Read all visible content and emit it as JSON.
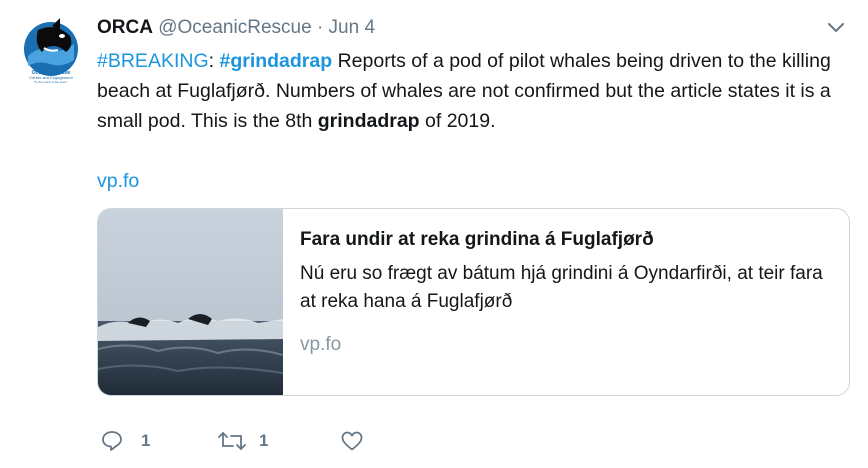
{
  "tweet": {
    "display_name": "ORCA",
    "handle": "@OceanicRescue",
    "separator": "·",
    "date": "Jun 4",
    "text": {
      "breaking": "#BREAKING",
      "colon": ":",
      "hashtag": "#grindadrap",
      "part1": " Reports of a pod of pilot whales being driven to the killing beach at Fuglafjørð. Numbers of whales are not confirmed but the article states it is a small pod. This is the 8th ",
      "bold_word": "grindadrap",
      "part2": " of 2019."
    },
    "link_text": "vp.fo",
    "avatar": {
      "lines": [
        "Oceanic Rescue",
        "Center and Engagement",
        "Be the voice of the ocean"
      ]
    },
    "card": {
      "title": "Fara undir at reka grindina á Fuglafjørð",
      "description": "Nú eru so frægt av bátum hjá grindini á Oyndarfirði, at teir fara at reka hana á Fuglafjørð",
      "domain": "vp.fo"
    },
    "actions": {
      "reply_count": "1",
      "retweet_count": "1",
      "like_count": ""
    }
  },
  "colors": {
    "link": "#1b95e0",
    "secondary": "#657786",
    "border": "#ccd6dd"
  }
}
